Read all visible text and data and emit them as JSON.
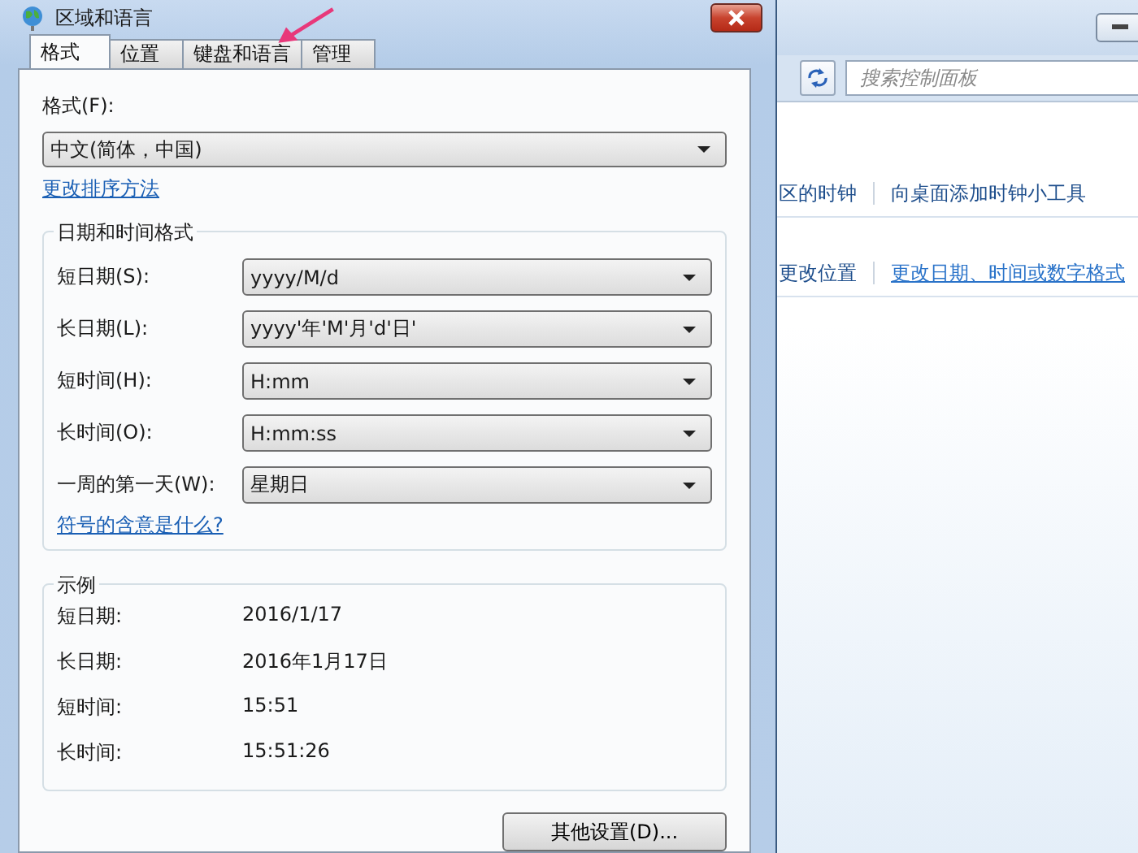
{
  "dialog": {
    "title": "区域和语言",
    "tabs": [
      {
        "label": "格式",
        "selected": true
      },
      {
        "label": "位置",
        "selected": false
      },
      {
        "label": "键盘和语言",
        "selected": false
      },
      {
        "label": "管理",
        "selected": false
      }
    ],
    "format_label": "格式(F):",
    "format_value": "中文(简体，中国)",
    "sort_link": "更改排序方法",
    "datetime_group": {
      "title": "日期和时间格式",
      "fields": [
        {
          "label": "短日期(S):",
          "value": "yyyy/M/d"
        },
        {
          "label": "长日期(L):",
          "value": "yyyy'年'M'月'd'日'"
        },
        {
          "label": "短时间(H):",
          "value": "H:mm"
        },
        {
          "label": "长时间(O):",
          "value": "H:mm:ss"
        },
        {
          "label": "一周的第一天(W):",
          "value": "星期日"
        }
      ],
      "link": "符号的含意是什么?"
    },
    "example_group": {
      "title": "示例",
      "rows": [
        {
          "label": "短日期:",
          "value": "2016/1/17"
        },
        {
          "label": "长日期:",
          "value": "2016年1月17日"
        },
        {
          "label": "短时间:",
          "value": "15:51"
        },
        {
          "label": "长时间:",
          "value": "15:51:26"
        }
      ]
    },
    "settings_button": "其他设置(D)..."
  },
  "background_window": {
    "search": {
      "placeholder": "搜索控制面板"
    },
    "link_rows": [
      [
        {
          "text": "区的时钟",
          "hovered": false
        },
        {
          "text": "向桌面添加时钟小工具",
          "hovered": false
        }
      ],
      [
        {
          "text": "更改位置",
          "hovered": false
        },
        {
          "text": "更改日期、时间或数字格式",
          "hovered": true
        }
      ]
    ]
  }
}
